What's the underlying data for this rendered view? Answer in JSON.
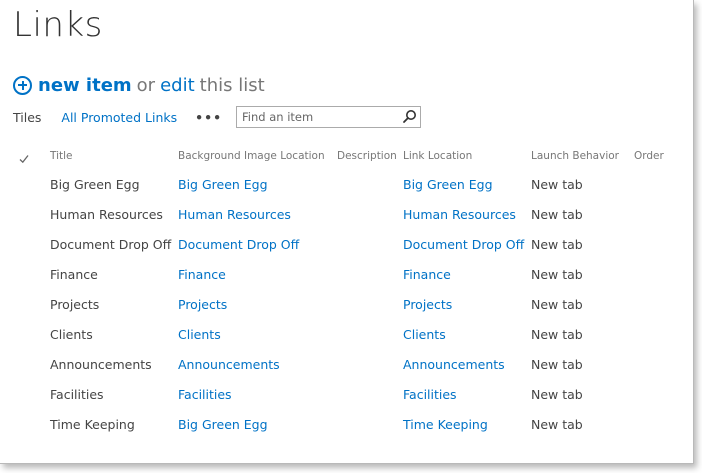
{
  "page": {
    "title": "Links"
  },
  "toolbar": {
    "new_item": "new item",
    "or": "or",
    "edit": "edit",
    "this_list": "this list"
  },
  "views": {
    "tabs": [
      {
        "label": "Tiles",
        "active": false
      },
      {
        "label": "All Promoted Links",
        "active": true
      }
    ],
    "more": "•••"
  },
  "search": {
    "placeholder": "Find an item",
    "value": ""
  },
  "table": {
    "columns": [
      "Title",
      "Background Image Location",
      "Description",
      "Link Location",
      "Launch Behavior",
      "Order"
    ],
    "rows": [
      {
        "title": "Big Green Egg",
        "background": "Big Green Egg",
        "description": "",
        "link": "Big Green Egg",
        "launch": "New tab",
        "order": ""
      },
      {
        "title": "Human Resources",
        "background": "Human Resources",
        "description": "",
        "link": "Human Resources",
        "launch": "New tab",
        "order": ""
      },
      {
        "title": "Document Drop Off",
        "background": "Document Drop Off",
        "description": "",
        "link": "Document Drop Off",
        "launch": "New tab",
        "order": ""
      },
      {
        "title": "Finance",
        "background": "Finance",
        "description": "",
        "link": "Finance",
        "launch": "New tab",
        "order": ""
      },
      {
        "title": "Projects",
        "background": "Projects",
        "description": "",
        "link": "Projects",
        "launch": "New tab",
        "order": ""
      },
      {
        "title": "Clients",
        "background": "Clients",
        "description": "",
        "link": "Clients",
        "launch": "New tab",
        "order": ""
      },
      {
        "title": "Announcements",
        "background": "Announcements",
        "description": "",
        "link": "Announcements",
        "launch": "New tab",
        "order": ""
      },
      {
        "title": "Facilities",
        "background": "Facilities",
        "description": "",
        "link": "Facilities",
        "launch": "New tab",
        "order": ""
      },
      {
        "title": "Time Keeping",
        "background": "Big Green Egg",
        "description": "",
        "link": "Time Keeping",
        "launch": "New tab",
        "order": ""
      }
    ]
  },
  "colors": {
    "accent": "#0072c6",
    "text": "#444444",
    "muted": "#777777"
  },
  "icons": {
    "add": "plus-circle-icon",
    "search": "magnifier-icon",
    "select_all": "checkmark-icon"
  }
}
